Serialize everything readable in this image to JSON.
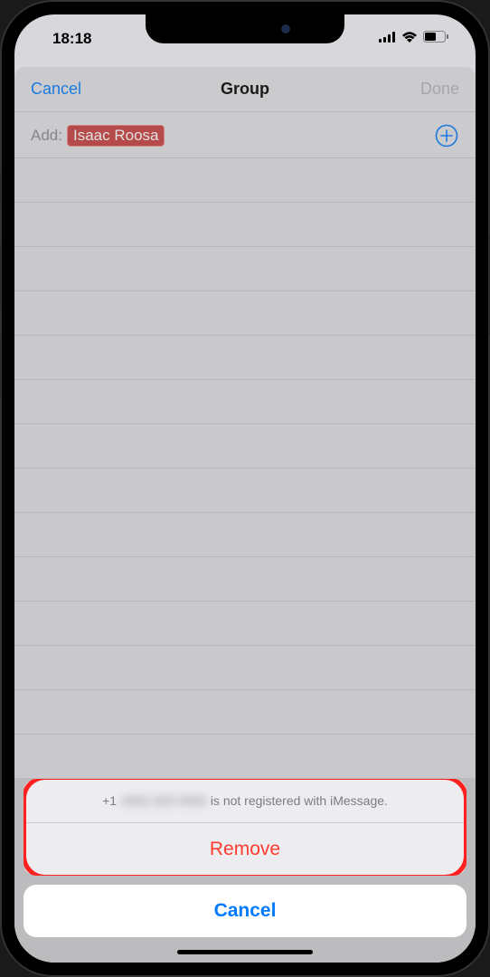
{
  "status": {
    "time": "18:18"
  },
  "nav": {
    "cancel": "Cancel",
    "title": "Group",
    "done": "Done"
  },
  "addRow": {
    "label": "Add:",
    "contact": "Isaac Roosa"
  },
  "actionSheet": {
    "phonePrefix": "+1",
    "phoneMasked": "(888) 888-8888",
    "messageSuffix": "is not registered with iMessage.",
    "remove": "Remove",
    "cancel": "Cancel"
  }
}
